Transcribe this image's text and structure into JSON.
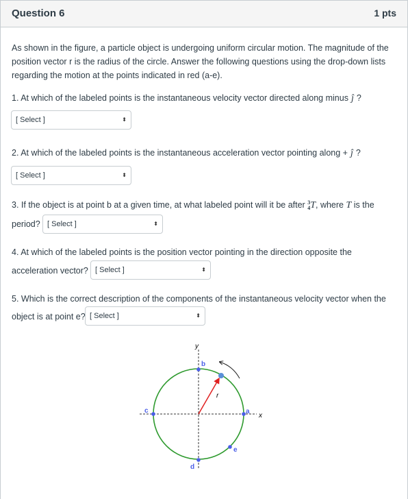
{
  "header": {
    "title": "Question 6",
    "points": "1 pts"
  },
  "intro": [
    "As shown in the figure, a particle object is undergoing uniform circular motion.  The magnitude of the",
    "position vector r is the radius of the circle.  Answer the following questions using the drop-down lists",
    "regarding the motion at the points indicated in red (a-e)."
  ],
  "q1": {
    "text": "1. At which of the labeled points is the instantaneous velocity vector directed along minus",
    "symbol": "ĵ",
    "end": "?",
    "select": "[ Select ]"
  },
  "q2": {
    "text": "2. At which of the labeled points is the instantaneous acceleration vector pointing along +",
    "symbol": "ĵ",
    "end": "?",
    "select": "[ Select ]"
  },
  "q3": {
    "text": "3. If the object is at point b at a given time, at what labeled point will it be after",
    "num": "3",
    "den": "4",
    "T": "T",
    "mid": ", where",
    "T2": "T",
    "end": "is the",
    "line2": "period?",
    "select": "[ Select ]"
  },
  "q4": {
    "line1": "4. At which of the labeled points is the position vector pointing in the direction opposite the",
    "line2": "acceleration vector?",
    "select": "[ Select ]"
  },
  "q5": {
    "line1": "5. Which is the correct description of the components of the instantaneous velocity vector when the",
    "line2": "object is at point e?",
    "select": "[ Select ]"
  },
  "figure": {
    "x_label": "x",
    "y_label": "y",
    "r_label": "r",
    "points": [
      "a",
      "b",
      "c",
      "d",
      "e"
    ],
    "circle_color": "#2e9a2e",
    "point_color": "#4a5ee8",
    "vector_color": "#e02020"
  }
}
